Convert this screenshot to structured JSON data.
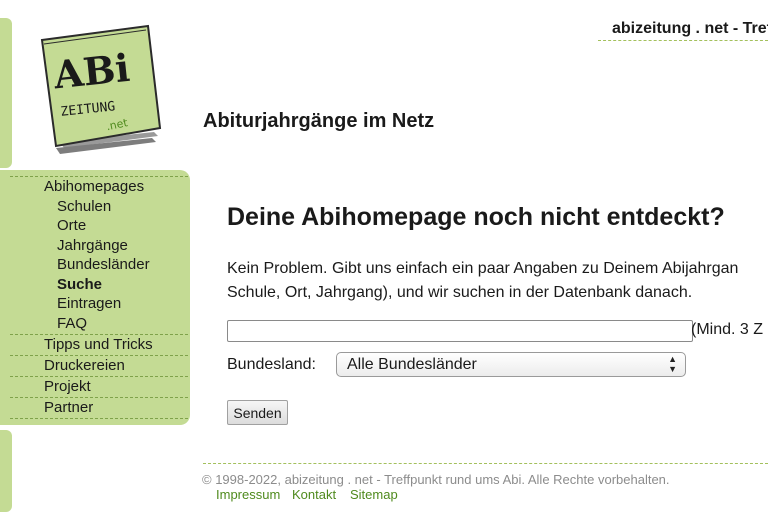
{
  "header": {
    "site_title": "abizeitung . net - Treff",
    "tagline": "Abiturjahrgänge im Netz"
  },
  "logo": {
    "line1": "ABi",
    "line2": "ZEITUNG",
    "line3": ".net"
  },
  "sidebar": {
    "sections": [
      {
        "label": "Abihomepages"
      },
      {
        "label": "Tipps und Tricks"
      },
      {
        "label": "Druckereien"
      },
      {
        "label": "Projekt"
      },
      {
        "label": "Partner"
      }
    ],
    "subitems": [
      {
        "label": "Schulen"
      },
      {
        "label": "Orte"
      },
      {
        "label": "Jahrgänge"
      },
      {
        "label": "Bundesländer"
      },
      {
        "label": "Suche",
        "active": true
      },
      {
        "label": "Eintragen"
      },
      {
        "label": "FAQ"
      }
    ]
  },
  "main": {
    "heading": "Deine Abihomepage noch nicht entdeckt?",
    "intro_line1": "Kein Problem. Gibt uns einfach ein paar Angaben zu Deinem Abijahrgan",
    "intro_line2": "Schule, Ort, Jahrgang), und wir suchen in der Datenbank danach.",
    "search_value": "",
    "search_hint": "(Mind. 3 Z",
    "bundesland_label": "Bundesland:",
    "bundesland_selected": "Alle Bundesländer",
    "submit_label": "Senden"
  },
  "footer": {
    "copyright": "© 1998-2022, abizeitung . net - Treffpunkt rund ums Abi. Alle Rechte vorbehalten.",
    "links": [
      {
        "label": "Impressum"
      },
      {
        "label": "Kontakt"
      },
      {
        "label": "Sitemap"
      }
    ]
  },
  "colors": {
    "sidebar_green": "#c4db94",
    "link_green": "#4f8a1d",
    "dash_green": "#a3c05c"
  }
}
